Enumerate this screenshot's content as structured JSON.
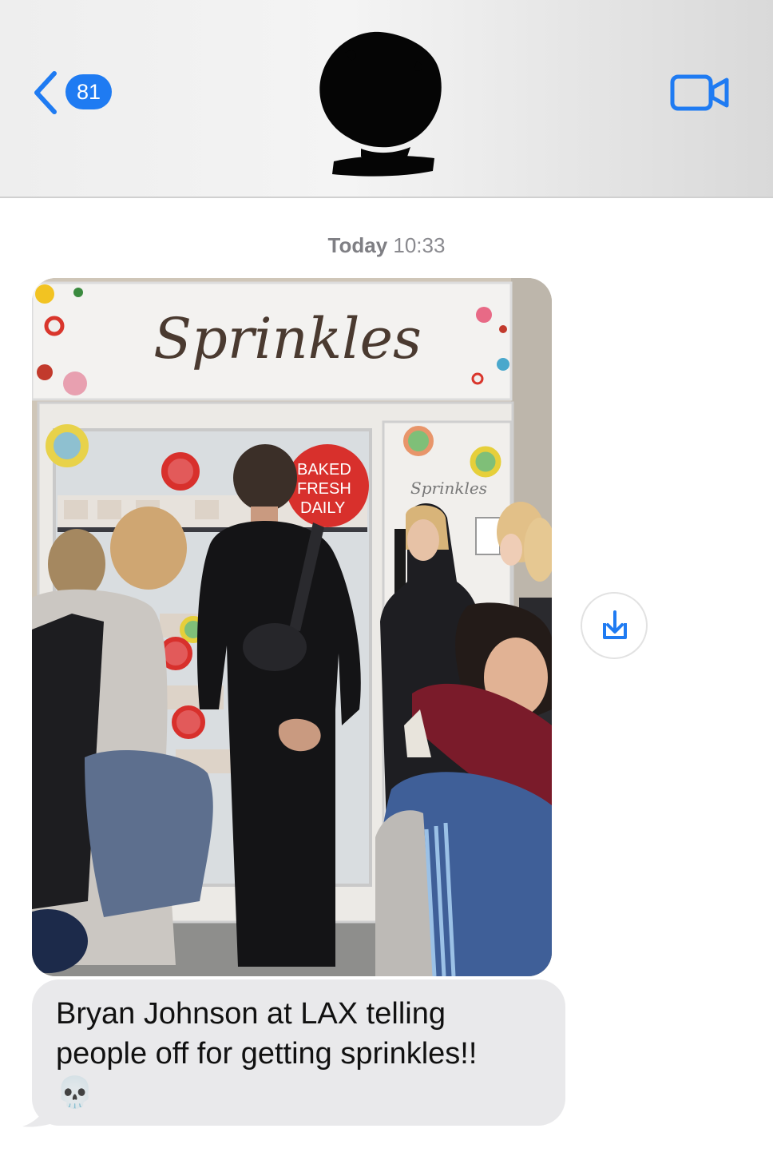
{
  "header": {
    "back_badge_count": "81",
    "icons": {
      "back": "chevron-left-icon",
      "video": "video-camera-icon"
    },
    "accent_color": "#1f7bf2"
  },
  "thread": {
    "timestamp_day": "Today",
    "timestamp_time": "10:33"
  },
  "photo": {
    "sign_text": "Sprinkles",
    "badge_line1": "BAKED",
    "badge_line2": "FRESH",
    "badge_line3": "DAILY",
    "door_logo": "Sprinkles"
  },
  "actions": {
    "save_icon": "download-icon"
  },
  "message": {
    "line1": "Bryan Johnson at LAX telling",
    "line2": "people off for getting sprinkles!!",
    "emoji": "💀",
    "bubble_color": "#e9e9eb"
  }
}
